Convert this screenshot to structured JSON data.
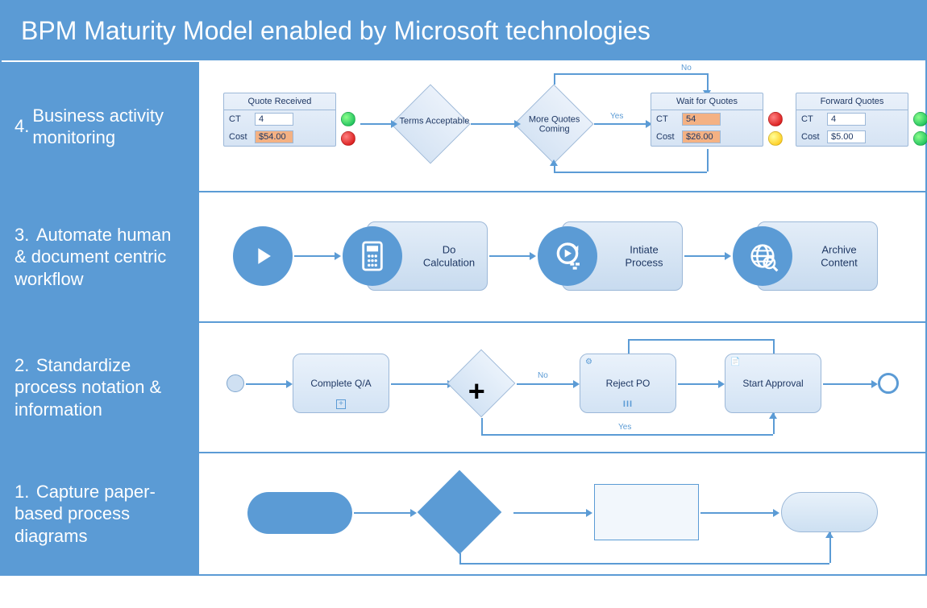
{
  "title": "BPM Maturity Model enabled by Microsoft technologies",
  "rows": {
    "r4": {
      "num": "4.",
      "label": "Business activity monitoring"
    },
    "r3": {
      "num": "3.",
      "label": "Automate human & document centric workflow"
    },
    "r2": {
      "num": "2.",
      "label": "Standardize process notation & information"
    },
    "r1": {
      "num": "1.",
      "label": "Capture paper-based process diagrams"
    }
  },
  "bam": {
    "quote_received": {
      "title": "Quote Received",
      "ct_k": "CT",
      "ct_v": "4",
      "cost_k": "Cost",
      "cost_v": "$54.00",
      "ct_dot": "green",
      "cost_dot": "red"
    },
    "terms": "Terms Acceptable",
    "more_quotes": "More Quotes Coming",
    "conn_yes": "Yes",
    "conn_no": "No",
    "wait_quotes": {
      "title": "Wait for Quotes",
      "ct_k": "CT",
      "ct_v": "54",
      "cost_k": "Cost",
      "cost_v": "$26.00",
      "ct_dot": "red",
      "cost_dot": "yellow"
    },
    "forward_quotes": {
      "title": "Forward Quotes",
      "ct_k": "CT",
      "ct_v": "4",
      "cost_k": "Cost",
      "cost_v": "$5.00",
      "ct_dot": "green",
      "cost_dot": "green"
    }
  },
  "wf": {
    "calc": "Do Calculation",
    "init": "Intiate Process",
    "archive": "Archive Content"
  },
  "bpmn": {
    "complete_qa": "Complete Q/A",
    "reject_po": "Reject PO",
    "start_approval": "Start Approval",
    "no": "No",
    "yes": "Yes"
  }
}
